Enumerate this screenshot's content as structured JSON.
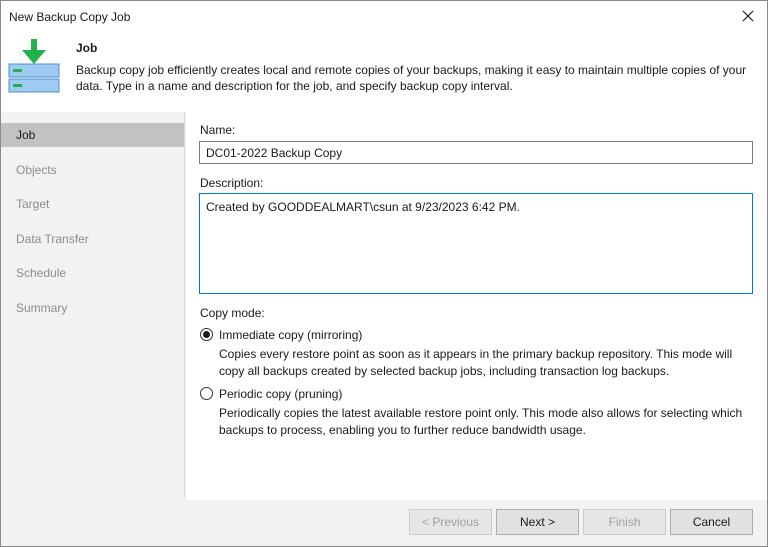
{
  "window": {
    "title": "New Backup Copy Job"
  },
  "header": {
    "title": "Job",
    "description": "Backup copy job efficiently creates local and remote copies of your backups, making it easy to maintain multiple copies of your data. Type in a name and description for the job, and specify backup copy interval."
  },
  "sidebar": {
    "items": [
      {
        "label": "Job",
        "active": true
      },
      {
        "label": "Objects"
      },
      {
        "label": "Target"
      },
      {
        "label": "Data Transfer"
      },
      {
        "label": "Schedule"
      },
      {
        "label": "Summary"
      }
    ]
  },
  "form": {
    "name_label": "Name:",
    "name_value": "DC01-2022 Backup Copy",
    "description_label": "Description:",
    "description_value": "Created by GOODDEALMART\\csun at 9/23/2023 6:42 PM.",
    "copy_mode_label": "Copy mode:",
    "options": [
      {
        "label": "Immediate copy (mirroring)",
        "checked": true,
        "hint": "Copies every restore point as soon as it appears in the primary backup repository. This mode will copy all backups created by selected backup jobs, including transaction log backups."
      },
      {
        "label": "Periodic copy (pruning)",
        "checked": false,
        "hint": "Periodically copies the latest available restore point only. This mode also allows for selecting which backups to process, enabling you to further reduce bandwidth usage."
      }
    ]
  },
  "footer": {
    "previous_label": "< Previous",
    "next_label": "Next >",
    "finish_label": "Finish",
    "cancel_label": "Cancel"
  },
  "colors": {
    "accent_green": "#22b14c",
    "icon_blue": "#9fcbf0",
    "focus_blue": "#0078d7",
    "active_nav": "#c2c2c2"
  }
}
